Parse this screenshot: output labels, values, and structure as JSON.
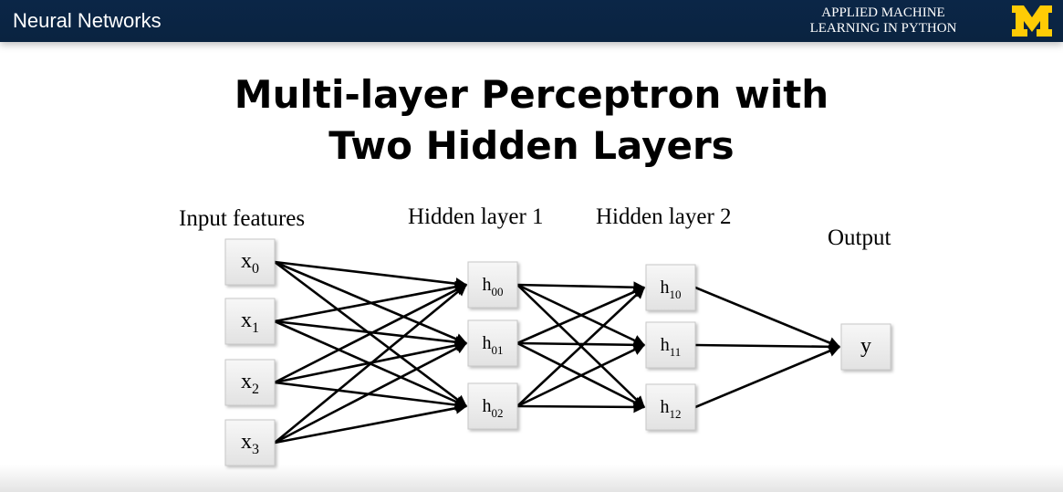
{
  "header": {
    "title": "Neural Networks",
    "course_line1": "APPLIED MACHINE",
    "course_line2": "LEARNING IN PYTHON",
    "logo_icon": "university-of-michigan-m-logo",
    "logo_color": "#ffcb05",
    "bar_color": "#0b2647"
  },
  "slide": {
    "title_line1": "Multi-layer Perceptron with",
    "title_line2": "Two Hidden Layers"
  },
  "diagram": {
    "labels": {
      "input": "Input features",
      "hidden1": "Hidden layer 1",
      "hidden2": "Hidden layer 2",
      "output": "Output"
    },
    "input_nodes": [
      {
        "base": "x",
        "sub": "0"
      },
      {
        "base": "x",
        "sub": "1"
      },
      {
        "base": "x",
        "sub": "2"
      },
      {
        "base": "x",
        "sub": "3"
      }
    ],
    "hidden1_nodes": [
      {
        "base": "h",
        "sub": "00"
      },
      {
        "base": "h",
        "sub": "01"
      },
      {
        "base": "h",
        "sub": "02"
      }
    ],
    "hidden2_nodes": [
      {
        "base": "h",
        "sub": "10"
      },
      {
        "base": "h",
        "sub": "11"
      },
      {
        "base": "h",
        "sub": "12"
      }
    ],
    "output_node": {
      "base": "y",
      "sub": ""
    }
  }
}
